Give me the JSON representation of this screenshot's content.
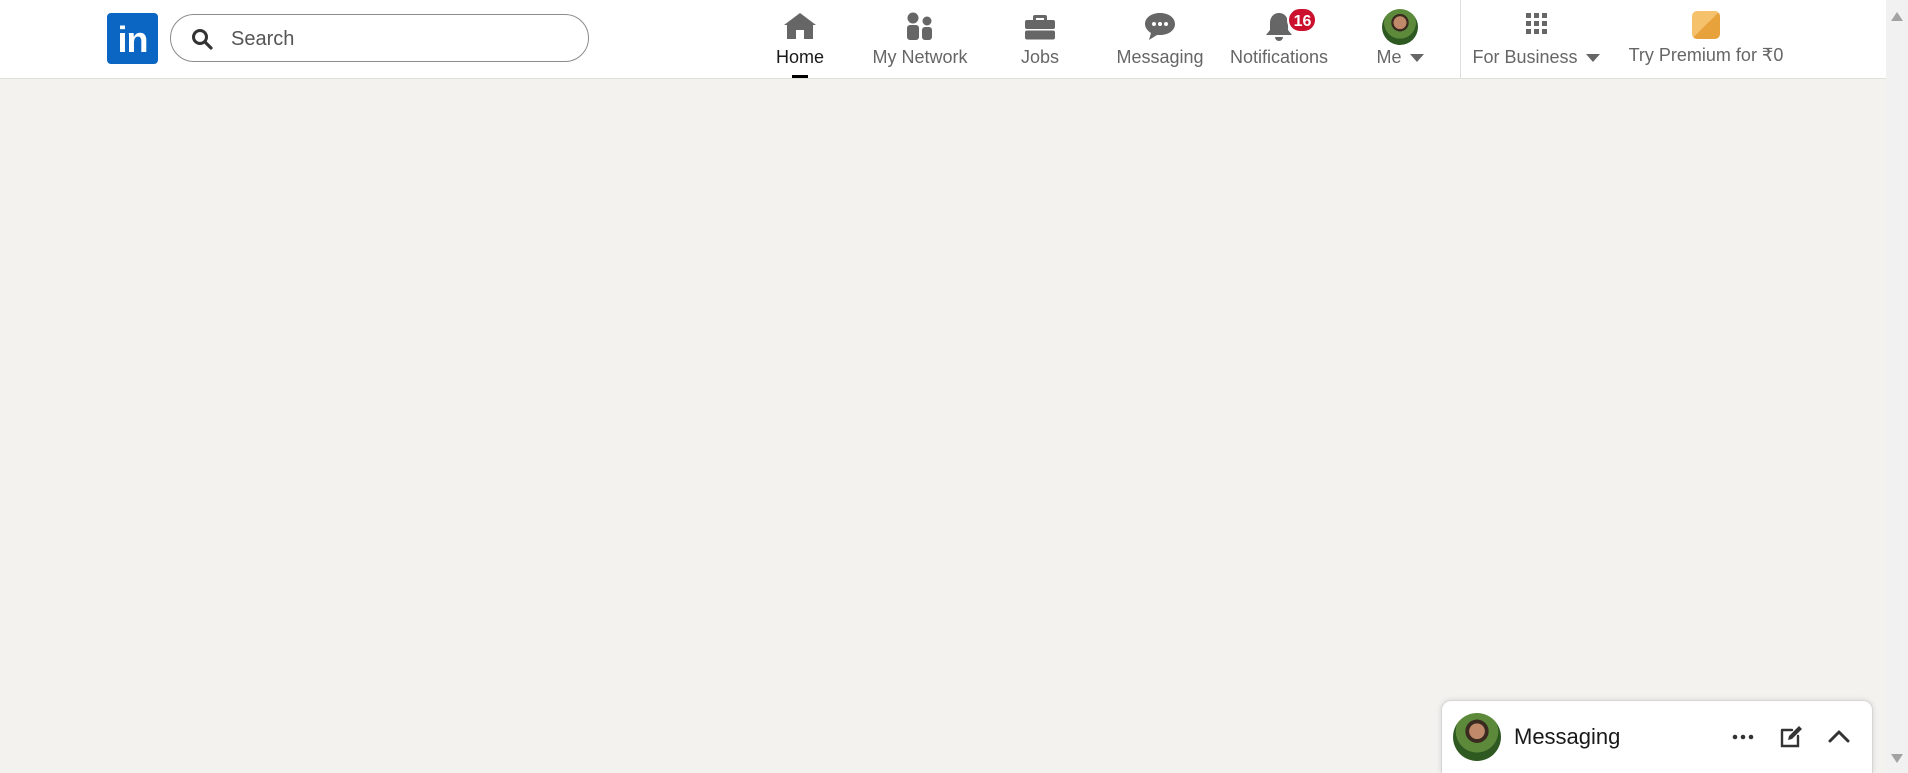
{
  "app": {
    "brand_color": "#0a66c2",
    "logo_text": "in"
  },
  "search": {
    "placeholder": "Search",
    "value": ""
  },
  "nav": {
    "home": {
      "label": "Home",
      "icon": "home-icon",
      "active": true
    },
    "network": {
      "label": "My Network",
      "icon": "people-icon"
    },
    "jobs": {
      "label": "Jobs",
      "icon": "briefcase-icon"
    },
    "messaging": {
      "label": "Messaging",
      "icon": "chat-icon"
    },
    "notifications": {
      "label": "Notifications",
      "icon": "bell-icon",
      "badge": "16"
    },
    "me": {
      "label": "Me",
      "icon": "avatar"
    },
    "business": {
      "label": "For Business",
      "icon": "grid-icon"
    },
    "premium": {
      "label": "Try Premium for ₹0",
      "icon": "premium-icon"
    }
  },
  "messaging_panel": {
    "title": "Messaging"
  },
  "colors": {
    "page_background": "#f3f2ef",
    "badge": "#cb112d",
    "nav_icon": "#666666"
  }
}
